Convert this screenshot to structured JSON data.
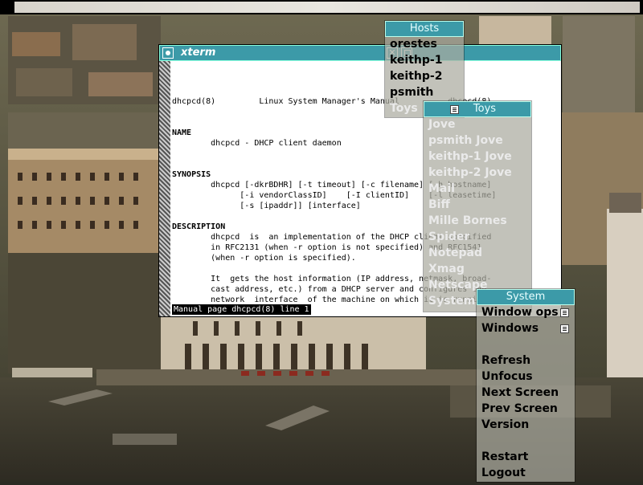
{
  "desktop": {
    "xterm": {
      "title": "xterm",
      "lines": [
        "dhcpcd(8)         Linux System Manager's Manual          dhcpcd(8)",
        "NAME",
        "        dhcpcd - DHCP client daemon",
        "SYNOPSIS",
        "        dhcpcd [-dkrBDHR] [-t timeout] [-c filename] [-h hostname]",
        "              [-i vendorClassID]    [-I clientID]    [-l leasetime]",
        "              [-s [ipaddr]] [interface]",
        "DESCRIPTION",
        "        dhcpcd  is  an implementation of the DHCP client specified",
        "        in RFC2131 (when -r option is not specified) and RFC1541",
        "        (when -r option is specified).",
        "        It  gets the host information (IP address, netmask, broad-",
        "        cast address, etc.) from a DHCP server and configures the",
        "        network  interface  of the machine on which it is running."
      ],
      "status": "Manual page dhcpcd(8) line 1"
    },
    "hosts_menu": {
      "title": "Hosts",
      "items": [
        "orestes",
        "keithp-1",
        "keithp-2",
        "psmith",
        "Toys"
      ]
    },
    "toys_menu": {
      "title": "Toys",
      "items": [
        "Jove",
        "psmith Jove",
        "keithp-1 Jove",
        "keithp-2 Jove",
        "Mail",
        "Biff",
        "Mille Bornes",
        "Spider",
        "Notepad",
        "Xmag",
        "Netscape",
        "System"
      ]
    },
    "system_menu": {
      "title": "System",
      "items": [
        "Window ops",
        "Windows",
        "Refresh",
        "Unfocus",
        "Next Screen",
        "Prev Screen",
        "Version",
        "Restart",
        "Logout"
      ]
    }
  }
}
